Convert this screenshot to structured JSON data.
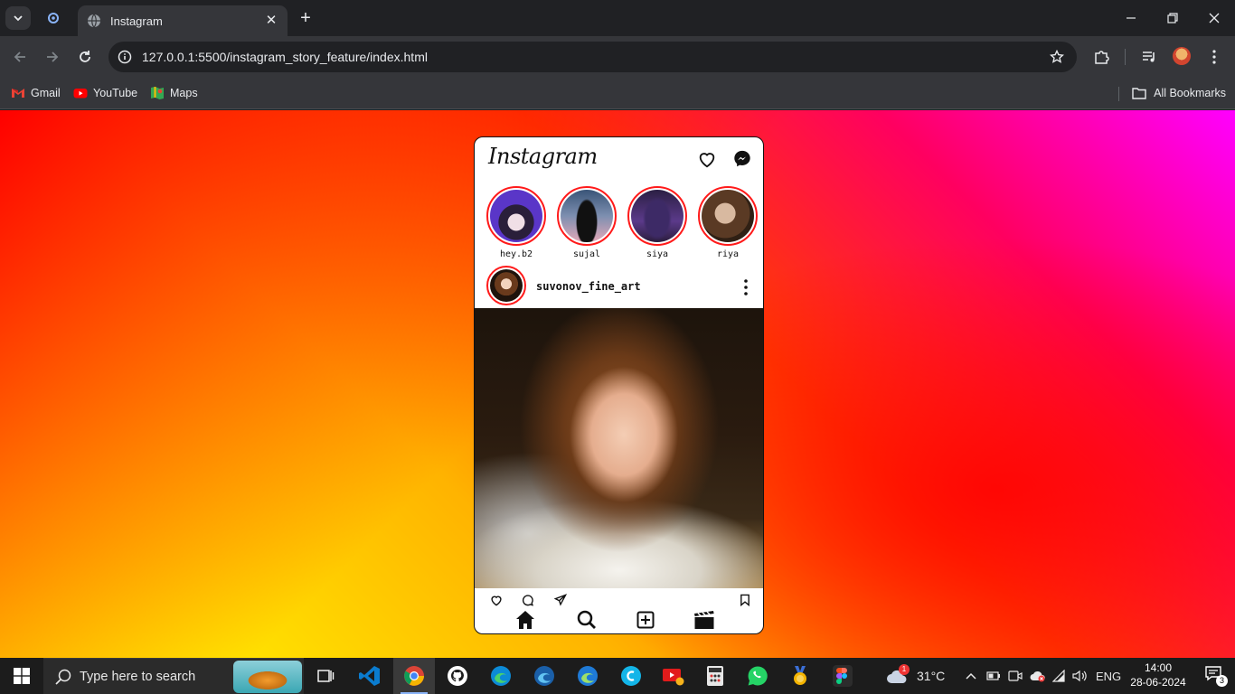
{
  "browser": {
    "tab_title": "Instagram",
    "url": "127.0.0.1:5500/instagram_story_feature/index.html",
    "bookmarks": [
      {
        "label": "Gmail",
        "icon": "gmail-icon"
      },
      {
        "label": "YouTube",
        "icon": "youtube-icon"
      },
      {
        "label": "Maps",
        "icon": "maps-icon"
      }
    ],
    "all_bookmarks_label": "All Bookmarks"
  },
  "instagram": {
    "logo": "Instagram",
    "stories": [
      {
        "name": "hey.b2"
      },
      {
        "name": "sujal"
      },
      {
        "name": "siya"
      },
      {
        "name": "riya"
      }
    ],
    "post": {
      "username": "suvonov_fine_art"
    }
  },
  "taskbar": {
    "search_placeholder": "Type here to search",
    "weather_temp": "31°C",
    "weather_badge": "1",
    "language": "ENG",
    "time": "14:00",
    "date": "28-06-2024",
    "notification_count": "3"
  },
  "colors": {
    "story_ring": "#ff1a1a",
    "gradient": [
      "#ffff00",
      "#ff0000",
      "#ff00ff"
    ],
    "browser_bg": "#202124",
    "toolbar_bg": "#35363a"
  }
}
